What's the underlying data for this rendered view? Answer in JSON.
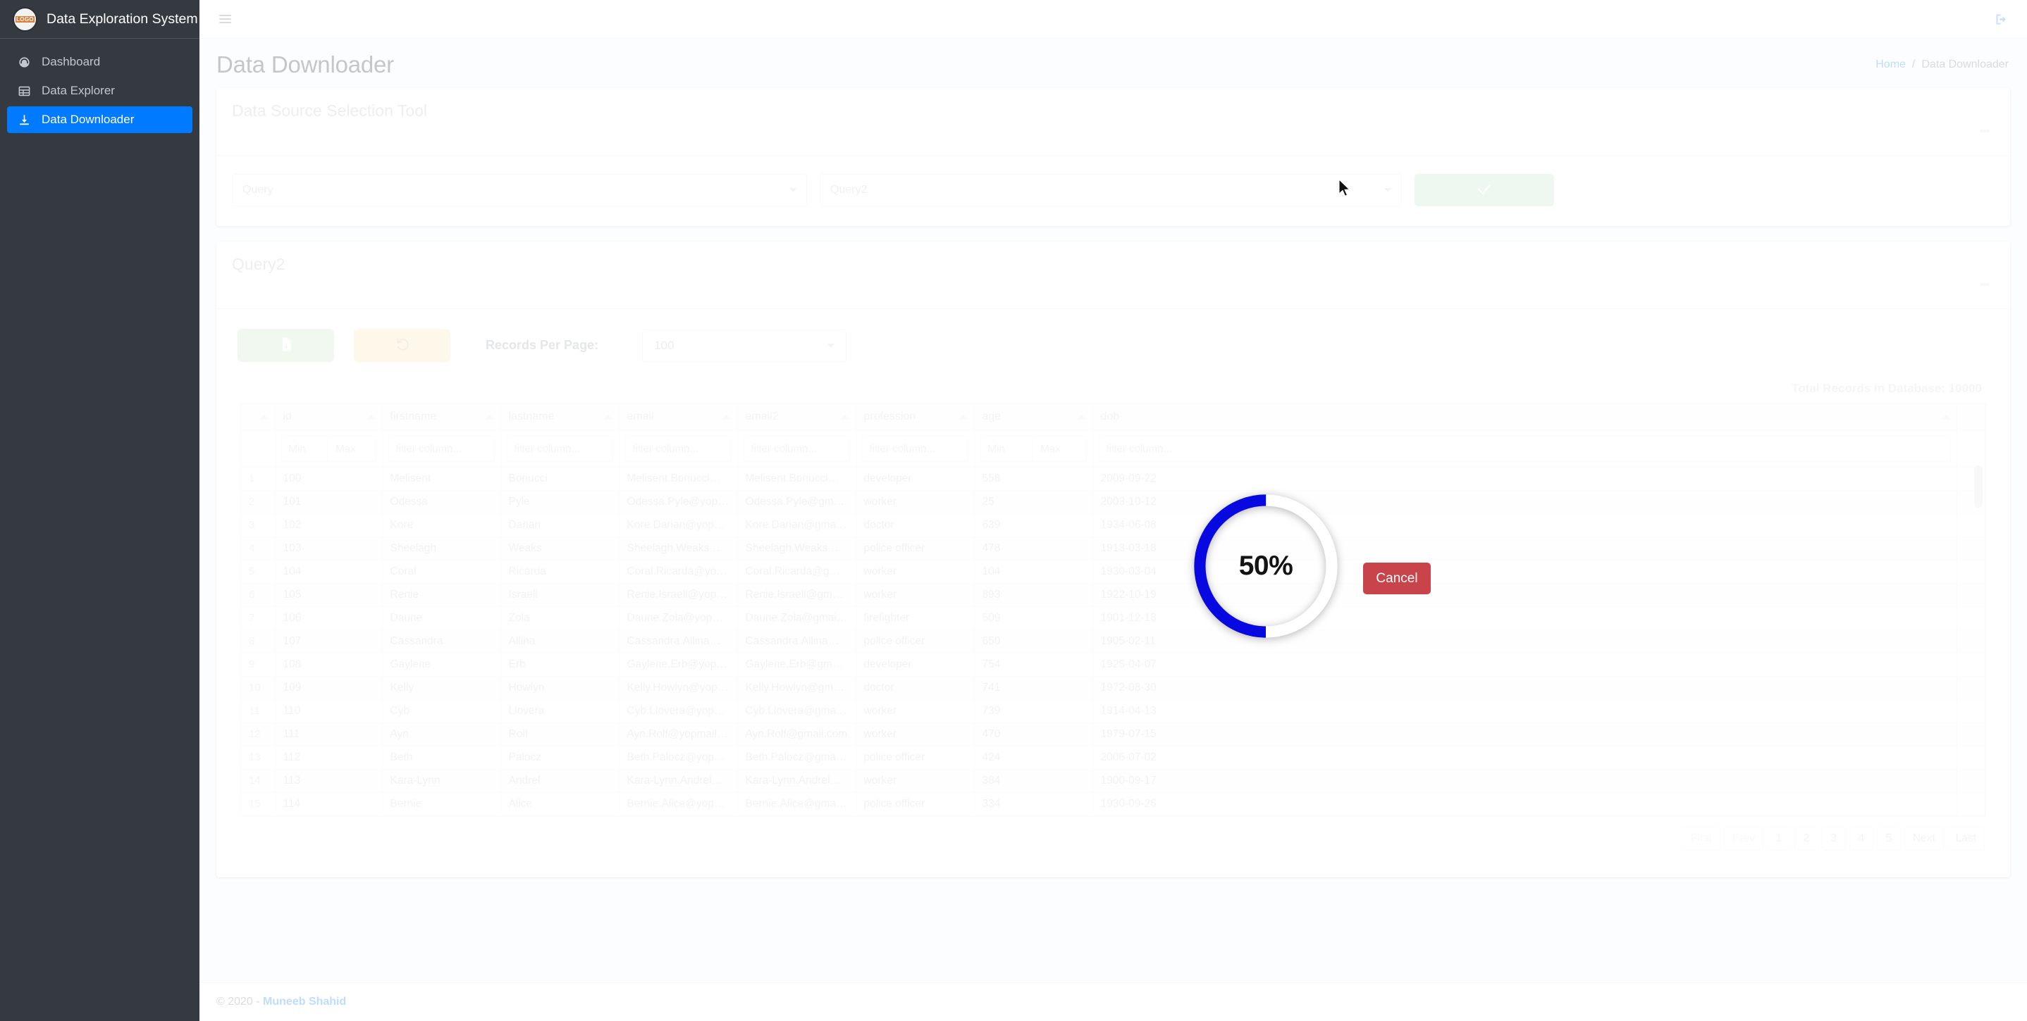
{
  "sidebar": {
    "brand": {
      "logo_text": "LOGO",
      "title": "Data Exploration System"
    },
    "items": [
      {
        "label": "Dashboard",
        "icon": "dashboard-icon",
        "active": false
      },
      {
        "label": "Data Explorer",
        "icon": "table-icon",
        "active": false
      },
      {
        "label": "Data Downloader",
        "icon": "download-icon",
        "active": true
      }
    ]
  },
  "topbar": {
    "menu_icon": "hamburger-icon",
    "logout_icon": "sign-out-icon"
  },
  "header": {
    "page_title": "Data Downloader",
    "breadcrumb": {
      "home": "Home",
      "separator": "/",
      "current": "Data Downloader"
    }
  },
  "data_source_card": {
    "title": "Data Source Selection Tool",
    "minimize_icon": "minus-icon",
    "query_select": {
      "value": "Query",
      "placeholder": "Query",
      "caret_icon": "caret-down-icon"
    },
    "query2_select": {
      "value": "Query2",
      "placeholder": "Query2",
      "caret_icon": "caret-down-icon"
    },
    "confirm_button": {
      "label": "✓",
      "icon": "check-icon",
      "color": "#bfe0c3"
    }
  },
  "result_card": {
    "title": "Query2",
    "minimize_icon": "minus-icon",
    "download_button": {
      "icon": "file-download-icon",
      "color": "#c4e3c6"
    },
    "reset_button": {
      "icon": "undo-icon",
      "color": "#f7e3ae"
    },
    "records_per_page_label": "Records Per Page:",
    "records_per_page_value": "100",
    "total_records_text": "Total Records in Database: 10000"
  },
  "table": {
    "columns": [
      {
        "key": "id",
        "label": "id",
        "filter": "range",
        "min_placeholder": "Min",
        "max_placeholder": "Max"
      },
      {
        "key": "firstname",
        "label": "firstname",
        "filter": "text",
        "placeholder": "filter column..."
      },
      {
        "key": "lastname",
        "label": "lastname",
        "filter": "text",
        "placeholder": "filter column..."
      },
      {
        "key": "email",
        "label": "email",
        "filter": "text",
        "placeholder": "filter column..."
      },
      {
        "key": "email2",
        "label": "email2",
        "filter": "text",
        "placeholder": "filter column..."
      },
      {
        "key": "profession",
        "label": "profession",
        "filter": "text",
        "placeholder": "filter column..."
      },
      {
        "key": "age",
        "label": "age",
        "filter": "range",
        "min_placeholder": "Min",
        "max_placeholder": "Max"
      },
      {
        "key": "dob",
        "label": "dob",
        "filter": "text",
        "placeholder": "filter column..."
      }
    ],
    "rows": [
      {
        "n": "1",
        "id": "100",
        "firstname": "Melisent",
        "lastname": "Bonucci",
        "email": "Melisent.Bonucci@...",
        "email2": "Melisent.Bonucci@...",
        "profession": "developer",
        "age": "558",
        "dob": "2009-09-22"
      },
      {
        "n": "2",
        "id": "101",
        "firstname": "Odessa",
        "lastname": "Pyle",
        "email": "Odessa.Pyle@yopm...",
        "email2": "Odessa.Pyle@gmail...",
        "profession": "worker",
        "age": "25",
        "dob": "2003-10-12"
      },
      {
        "n": "3",
        "id": "102",
        "firstname": "Kore",
        "lastname": "Darian",
        "email": "Kore.Darian@yopm...",
        "email2": "Kore.Darian@gmail....",
        "profession": "doctor",
        "age": "639",
        "dob": "1934-06-08"
      },
      {
        "n": "4",
        "id": "103",
        "firstname": "Sheelagh",
        "lastname": "Weaks",
        "email": "Sheelagh.Weaks@y...",
        "email2": "Sheelagh.Weaks@g...",
        "profession": "police officer",
        "age": "478",
        "dob": "1913-03-18"
      },
      {
        "n": "5",
        "id": "104",
        "firstname": "Coral",
        "lastname": "Ricarda",
        "email": "Coral.Ricarda@yop...",
        "email2": "Coral.Ricarda@gma...",
        "profession": "worker",
        "age": "104",
        "dob": "1930-03-04"
      },
      {
        "n": "6",
        "id": "105",
        "firstname": "Renie",
        "lastname": "Israeli",
        "email": "Renie.Israeli@yopm...",
        "email2": "Renie.Israeli@gmail...",
        "profession": "worker",
        "age": "893",
        "dob": "1922-10-19"
      },
      {
        "n": "7",
        "id": "106",
        "firstname": "Daune",
        "lastname": "Zola",
        "email": "Daune.Zola@yopma...",
        "email2": "Daune.Zola@gmail....",
        "profession": "firefighter",
        "age": "509",
        "dob": "1901-12-18"
      },
      {
        "n": "8",
        "id": "107",
        "firstname": "Cassandra",
        "lastname": "Allina",
        "email": "Cassandra.Allina@y...",
        "email2": "Cassandra.Allina@g...",
        "profession": "police officer",
        "age": "650",
        "dob": "1905-02-11"
      },
      {
        "n": "9",
        "id": "108",
        "firstname": "Gaylene",
        "lastname": "Erb",
        "email": "Gaylene.Erb@yopm...",
        "email2": "Gaylene.Erb@gmail....",
        "profession": "developer",
        "age": "754",
        "dob": "1925-04-07"
      },
      {
        "n": "10",
        "id": "109",
        "firstname": "Kelly",
        "lastname": "Howlyn",
        "email": "Kelly.Howlyn@yopm...",
        "email2": "Kelly.Howlyn@gmail...",
        "profession": "doctor",
        "age": "741",
        "dob": "1972-08-30"
      },
      {
        "n": "11",
        "id": "110",
        "firstname": "Cyb",
        "lastname": "Llovera",
        "email": "Cyb.Llovera@yopm...",
        "email2": "Cyb.Llovera@gmail....",
        "profession": "worker",
        "age": "739",
        "dob": "1914-04-13"
      },
      {
        "n": "12",
        "id": "111",
        "firstname": "Ayn",
        "lastname": "Rolf",
        "email": "Ayn.Rolf@yopmail.c...",
        "email2": "Ayn.Rolf@gmail.com",
        "profession": "worker",
        "age": "470",
        "dob": "1979-07-15"
      },
      {
        "n": "13",
        "id": "112",
        "firstname": "Beth",
        "lastname": "Palocz",
        "email": "Beth.Palocz@yopm...",
        "email2": "Beth.Palocz@gmail...",
        "profession": "police officer",
        "age": "424",
        "dob": "2006-07-02"
      },
      {
        "n": "14",
        "id": "113",
        "firstname": "Kara-Lynn",
        "lastname": "Andrel",
        "email": "Kara-Lynn.Andrel@...",
        "email2": "Kara-Lynn.Andrel@...",
        "profession": "worker",
        "age": "384",
        "dob": "1900-09-17"
      },
      {
        "n": "15",
        "id": "114",
        "firstname": "Bernie",
        "lastname": "Alice",
        "email": "Bernie.Alice@yopm...",
        "email2": "Bernie.Alice@gmail...",
        "profession": "police officer",
        "age": "334",
        "dob": "1930-09-26"
      }
    ]
  },
  "pagination": {
    "buttons": [
      {
        "label": "First",
        "state": "disabled"
      },
      {
        "label": "Prev",
        "state": "disabled"
      },
      {
        "label": "1",
        "state": "active"
      },
      {
        "label": "2",
        "state": "normal"
      },
      {
        "label": "3",
        "state": "normal"
      },
      {
        "label": "4",
        "state": "normal"
      },
      {
        "label": "5",
        "state": "normal"
      },
      {
        "label": "Next",
        "state": "normal"
      },
      {
        "label": "Last",
        "state": "normal"
      }
    ]
  },
  "progress_overlay": {
    "percent_label": "50%",
    "percent_value": 50,
    "ring_color": "#0808e0",
    "track_color": "#ffffff",
    "cancel_label": "Cancel",
    "cancel_color": "#c9444a"
  },
  "footer": {
    "copyright": "© 2020 - ",
    "author": "Muneeb Shahid"
  }
}
